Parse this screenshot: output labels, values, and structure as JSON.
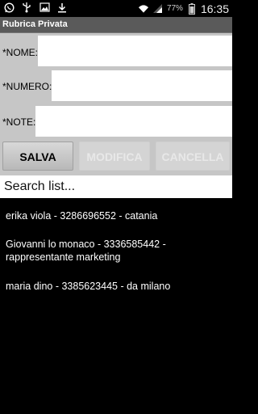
{
  "status_bar": {
    "battery": "77%",
    "time": "16:35",
    "icons": [
      "whatsapp-icon",
      "usb-icon",
      "image-icon",
      "download-icon",
      "wifi-icon",
      "signal-icon",
      "battery-icon"
    ]
  },
  "title": "Rubrica Privata",
  "form": {
    "name_label": "*NOME:",
    "number_label": "*NUMERO:",
    "note_label": "*NOTE:",
    "name_value": "",
    "number_value": "",
    "note_value": ""
  },
  "buttons": {
    "save": "SALVA",
    "edit": "MODIFICA",
    "delete": "CANCELLA"
  },
  "search": {
    "placeholder": "Search list..."
  },
  "contacts": [
    "erika viola - 3286696552 - catania",
    "Giovanni lo monaco - 3336585442 - rappresentante marketing",
    "maria dino - 3385623445 - da milano"
  ]
}
